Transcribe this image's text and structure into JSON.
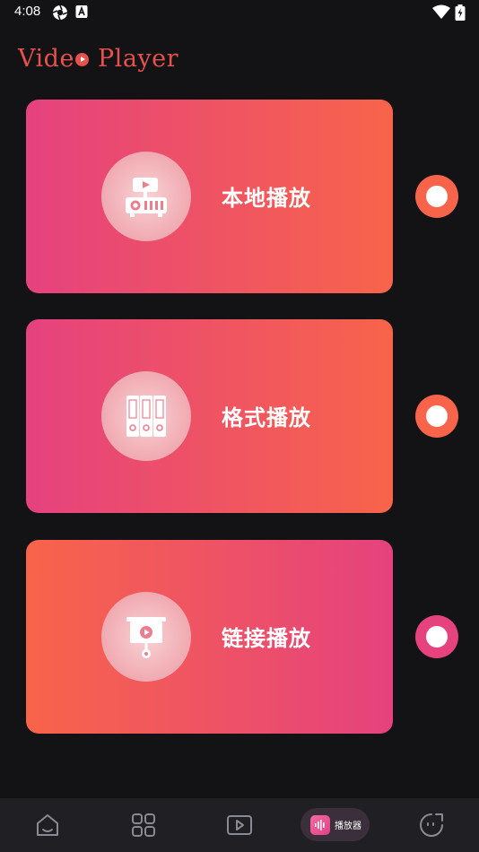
{
  "status_bar": {
    "time": "4:08",
    "icons": [
      "aperture-icon",
      "a-badge-icon",
      "wifi-icon",
      "battery-icon"
    ]
  },
  "app": {
    "title_left": "Vide",
    "title_right": "Player"
  },
  "cards": [
    {
      "label": "本地播放",
      "icon": "projector-icon",
      "gradient": "warm",
      "toggle_color": "#f8644a"
    },
    {
      "label": "格式播放",
      "icon": "format-binders-icon",
      "gradient": "warm",
      "toggle_color": "#f8644a"
    },
    {
      "label": "链接播放",
      "icon": "presentation-play-icon",
      "gradient": "cool",
      "toggle_color": "#e5427e"
    }
  ],
  "bottom_nav": {
    "items": [
      "home-icon",
      "grid-icon",
      "video-icon",
      "player-icon",
      "smile-icon"
    ],
    "active_label": "播放器"
  },
  "colors": {
    "background": "#131316",
    "accent_red": "#e8504c",
    "gradient_pink": "#e5427e",
    "gradient_orange": "#f8644a",
    "nav_background": "#1f1f24"
  }
}
